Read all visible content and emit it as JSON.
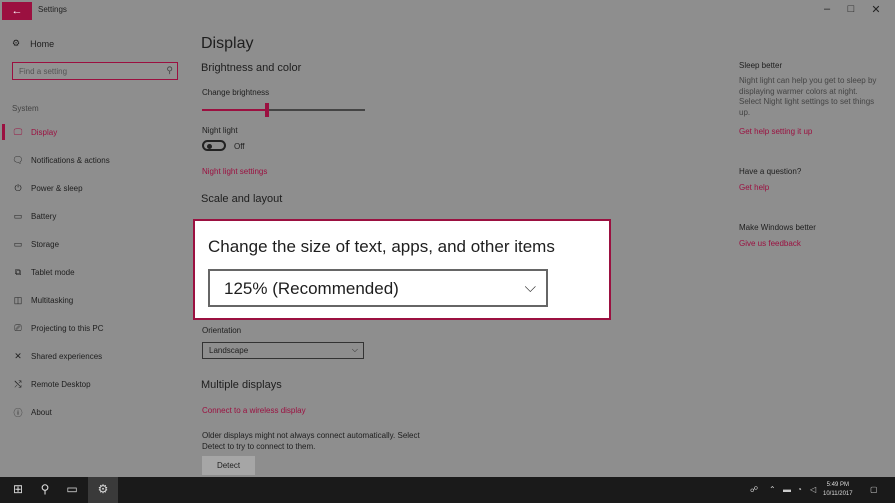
{
  "window": {
    "title": "Settings",
    "back_icon": "←",
    "minimize": "–",
    "maximize": "□",
    "close": "✕"
  },
  "sidebar": {
    "home_label": "Home",
    "search_placeholder": "Find a setting",
    "section_label": "System",
    "items": [
      {
        "label": "Display",
        "icon": "🖵",
        "active": true
      },
      {
        "label": "Notifications & actions",
        "icon": "🗨"
      },
      {
        "label": "Power & sleep",
        "icon": "⏻"
      },
      {
        "label": "Battery",
        "icon": "▭"
      },
      {
        "label": "Storage",
        "icon": "▭"
      },
      {
        "label": "Tablet mode",
        "icon": "⧉"
      },
      {
        "label": "Multitasking",
        "icon": "◫"
      },
      {
        "label": "Projecting to this PC",
        "icon": "⎚"
      },
      {
        "label": "Shared experiences",
        "icon": "✕"
      },
      {
        "label": "Remote Desktop",
        "icon": "⤭"
      },
      {
        "label": "About",
        "icon": "ⓘ"
      }
    ]
  },
  "main": {
    "title": "Display",
    "brightness_heading": "Brightness and color",
    "change_brightness_label": "Change brightness",
    "brightness_level": 0.4,
    "night_light_label": "Night light",
    "night_light_state": "Off",
    "night_light_settings_link": "Night light settings",
    "scale_heading": "Scale and layout",
    "orientation_label": "Orientation",
    "orientation_value": "Landscape",
    "multiple_displays_heading": "Multiple displays",
    "wireless_link": "Connect to a wireless display",
    "older_displays_line1": "Older displays might not always connect automatically. Select",
    "older_displays_line2": "Detect to try to connect to them.",
    "detect_button": "Detect"
  },
  "popup": {
    "title": "Change the size of text, apps, and other items",
    "value": "125% (Recommended)"
  },
  "right_panel": {
    "sleep_heading": "Sleep better",
    "sleep_text": "Night light can help you get to sleep by displaying warmer colors at night. Select Night light settings to set things up.",
    "sleep_link": "Get help setting it up",
    "question_heading": "Have a question?",
    "question_link": "Get help",
    "better_heading": "Make Windows better",
    "better_link": "Give us feedback"
  },
  "taskbar": {
    "time": "5:49 PM",
    "date": "10/11/2017"
  },
  "colors": {
    "accent": "#9b1040",
    "background": "#8e8e8e",
    "taskbar": "#1a1a1a"
  }
}
